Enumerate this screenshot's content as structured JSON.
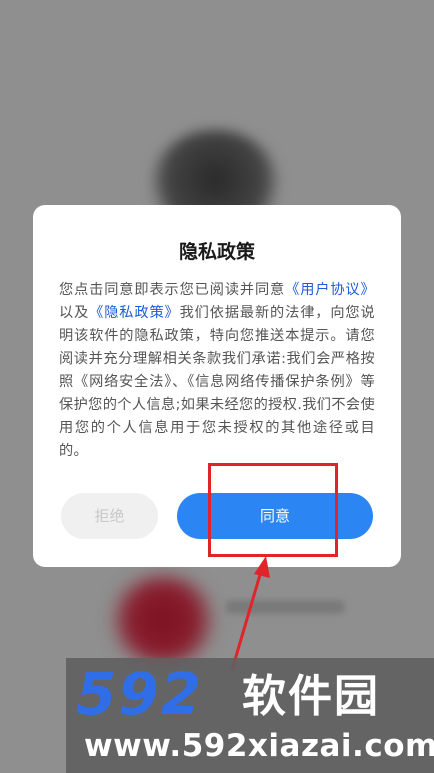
{
  "dialog": {
    "title": "隐私政策",
    "body": {
      "text_1": "您点击同意即表示您已阅读并同意",
      "link_user_agreement": "《用户协议》",
      "text_2": "以及",
      "link_privacy_policy": "《隐私政策》",
      "text_3": "我们依据最新的法律，向您说明该软件的隐私政策，特向您推送本提示。请您阅读并充分理解相关条款我们承诺:我们会严格按照《网络安全法》、《信息网络传播保护条例》等保护您的个人信息;如果未经您的授权.我们不会使用您的个人信息用于您未授权的其他途径或目的。"
    },
    "reject_label": "拒绝",
    "agree_label": "同意"
  },
  "colors": {
    "link": "#1d5bd8",
    "agree_button": "#2b86f3",
    "highlight": "#e0242a"
  },
  "watermark": {
    "logo_number": "592",
    "logo_text": "软件园",
    "url": "www.592xiazai.com"
  }
}
